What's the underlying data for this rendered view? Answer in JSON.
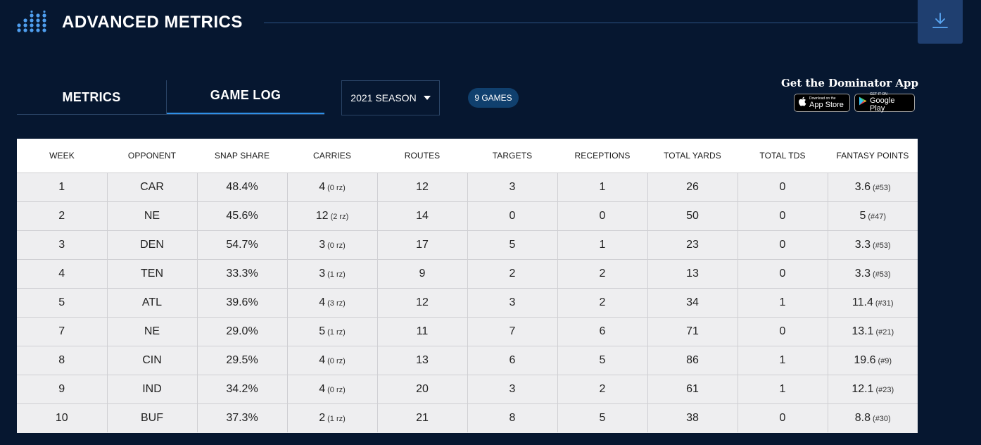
{
  "header": {
    "title": "ADVANCED METRICS",
    "logo_icon": "dot-grid-icon",
    "download_icon": "download-icon"
  },
  "tabs": [
    {
      "label": "METRICS",
      "active": false
    },
    {
      "label": "GAME LOG",
      "active": true
    }
  ],
  "season_select": {
    "value": "2021 SEASON",
    "icon": "caret-down-icon"
  },
  "games_badge": "9 GAMES",
  "app_promo": {
    "title": "Get the Dominator App",
    "apple": {
      "small": "Download on the",
      "big": "App Store",
      "icon": "apple-icon"
    },
    "google": {
      "small": "GET IT ON",
      "big": "Google Play",
      "icon": "google-play-icon"
    }
  },
  "colors": {
    "background": "#061730",
    "accent": "#2e8fe6",
    "badge": "#10406e",
    "download_button": "#1f3f70",
    "table_row": "#eeeef0"
  },
  "table": {
    "columns": [
      "WEEK",
      "OPPONENT",
      "SNAP SHARE",
      "CARRIES",
      "ROUTES",
      "TARGETS",
      "RECEPTIONS",
      "TOTAL YARDS",
      "TOTAL TDS",
      "FANTASY POINTS"
    ],
    "rows": [
      {
        "week": "1",
        "opponent": "CAR",
        "snap_share": "48.4%",
        "carries": "4",
        "carries_rz": "(0 rz)",
        "routes": "12",
        "targets": "3",
        "receptions": "1",
        "total_yards": "26",
        "total_tds": "0",
        "fantasy_points": "3.6",
        "fantasy_rank": "(#53)"
      },
      {
        "week": "2",
        "opponent": "NE",
        "snap_share": "45.6%",
        "carries": "12",
        "carries_rz": "(2 rz)",
        "routes": "14",
        "targets": "0",
        "receptions": "0",
        "total_yards": "50",
        "total_tds": "0",
        "fantasy_points": "5",
        "fantasy_rank": "(#47)"
      },
      {
        "week": "3",
        "opponent": "DEN",
        "snap_share": "54.7%",
        "carries": "3",
        "carries_rz": "(0 rz)",
        "routes": "17",
        "targets": "5",
        "receptions": "1",
        "total_yards": "23",
        "total_tds": "0",
        "fantasy_points": "3.3",
        "fantasy_rank": "(#53)"
      },
      {
        "week": "4",
        "opponent": "TEN",
        "snap_share": "33.3%",
        "carries": "3",
        "carries_rz": "(1 rz)",
        "routes": "9",
        "targets": "2",
        "receptions": "2",
        "total_yards": "13",
        "total_tds": "0",
        "fantasy_points": "3.3",
        "fantasy_rank": "(#53)"
      },
      {
        "week": "5",
        "opponent": "ATL",
        "snap_share": "39.6%",
        "carries": "4",
        "carries_rz": "(3 rz)",
        "routes": "12",
        "targets": "3",
        "receptions": "2",
        "total_yards": "34",
        "total_tds": "1",
        "fantasy_points": "11.4",
        "fantasy_rank": "(#31)"
      },
      {
        "week": "7",
        "opponent": "NE",
        "snap_share": "29.0%",
        "carries": "5",
        "carries_rz": "(1 rz)",
        "routes": "11",
        "targets": "7",
        "receptions": "6",
        "total_yards": "71",
        "total_tds": "0",
        "fantasy_points": "13.1",
        "fantasy_rank": "(#21)"
      },
      {
        "week": "8",
        "opponent": "CIN",
        "snap_share": "29.5%",
        "carries": "4",
        "carries_rz": "(0 rz)",
        "routes": "13",
        "targets": "6",
        "receptions": "5",
        "total_yards": "86",
        "total_tds": "1",
        "fantasy_points": "19.6",
        "fantasy_rank": "(#9)"
      },
      {
        "week": "9",
        "opponent": "IND",
        "snap_share": "34.2%",
        "carries": "4",
        "carries_rz": "(0 rz)",
        "routes": "20",
        "targets": "3",
        "receptions": "2",
        "total_yards": "61",
        "total_tds": "1",
        "fantasy_points": "12.1",
        "fantasy_rank": "(#23)"
      },
      {
        "week": "10",
        "opponent": "BUF",
        "snap_share": "37.3%",
        "carries": "2",
        "carries_rz": "(1 rz)",
        "routes": "21",
        "targets": "8",
        "receptions": "5",
        "total_yards": "38",
        "total_tds": "0",
        "fantasy_points": "8.8",
        "fantasy_rank": "(#30)"
      }
    ]
  }
}
